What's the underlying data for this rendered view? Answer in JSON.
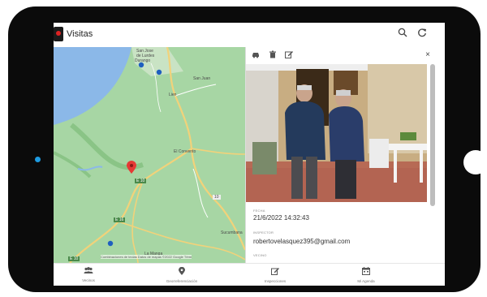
{
  "app": {
    "title": "Visitas",
    "search_icon": "search-icon",
    "refresh_icon": "refresh-icon"
  },
  "map": {
    "labels": {
      "san_jose": "San Jose\nde Lurdes",
      "durango": "Durango",
      "san_juan": "San Juan",
      "lien": "Lien",
      "el_convento": "El Convento",
      "la_manga": "La Manga",
      "sucumbana": "Sucumbana"
    },
    "road_shields": [
      "E 10",
      "10",
      "E 16",
      "E 10"
    ],
    "footer": "Combinaciones de teclas   Datos de mapas ©2022 Google   Térm"
  },
  "detail": {
    "toolbar_icons": [
      "car-icon",
      "trash-icon",
      "edit-icon"
    ],
    "close_label": "×",
    "fecha_label": "FECHA",
    "fecha_value": "21/6/2022 14:32:43",
    "inspector_label": "INSPECTOR",
    "inspector_value": "robertovelasquez395@gmail.com",
    "vecino_label": "VECINO"
  },
  "nav": {
    "items": [
      {
        "label": "Vecinos",
        "icon": "users-icon"
      },
      {
        "label": "Georreferenciación",
        "icon": "map-pin-icon"
      },
      {
        "label": "Inspecciones",
        "icon": "edit-icon"
      },
      {
        "label": "Mi Agenda",
        "icon": "calendar-icon"
      }
    ]
  },
  "colors": {
    "map_green": "#a7d6a4",
    "water": "#8bb8e8",
    "road": "#f2d27a",
    "marker_red": "#e53935",
    "marker_blue": "#1f5fbf"
  }
}
